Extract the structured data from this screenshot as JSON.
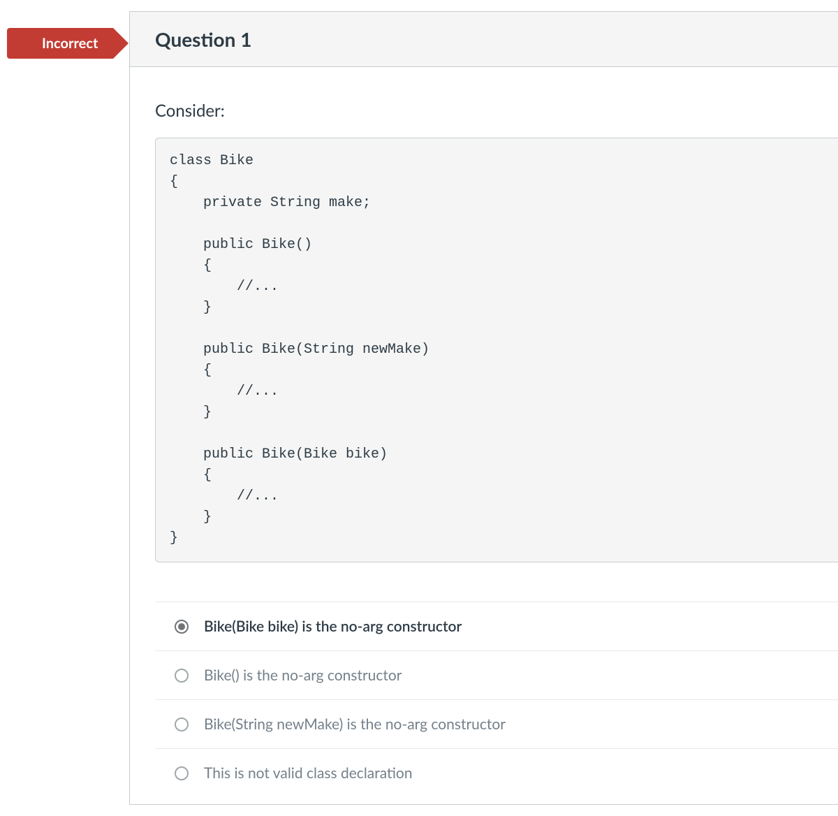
{
  "status": {
    "label": "Incorrect"
  },
  "question": {
    "title": "Question 1",
    "prompt": "Consider:",
    "code": "class Bike\n{\n    private String make;\n\n    public Bike()\n    {\n        //...\n    }\n\n    public Bike(String newMake)\n    {\n        //...\n    }\n\n    public Bike(Bike bike)\n    {\n        //...\n    }\n}"
  },
  "answers": [
    {
      "label": "Bike(Bike bike) is the no-arg constructor",
      "selected": true
    },
    {
      "label": "Bike() is the no-arg constructor",
      "selected": false
    },
    {
      "label": "Bike(String newMake) is the no-arg constructor",
      "selected": false
    },
    {
      "label": "This is not valid class declaration",
      "selected": false
    }
  ]
}
